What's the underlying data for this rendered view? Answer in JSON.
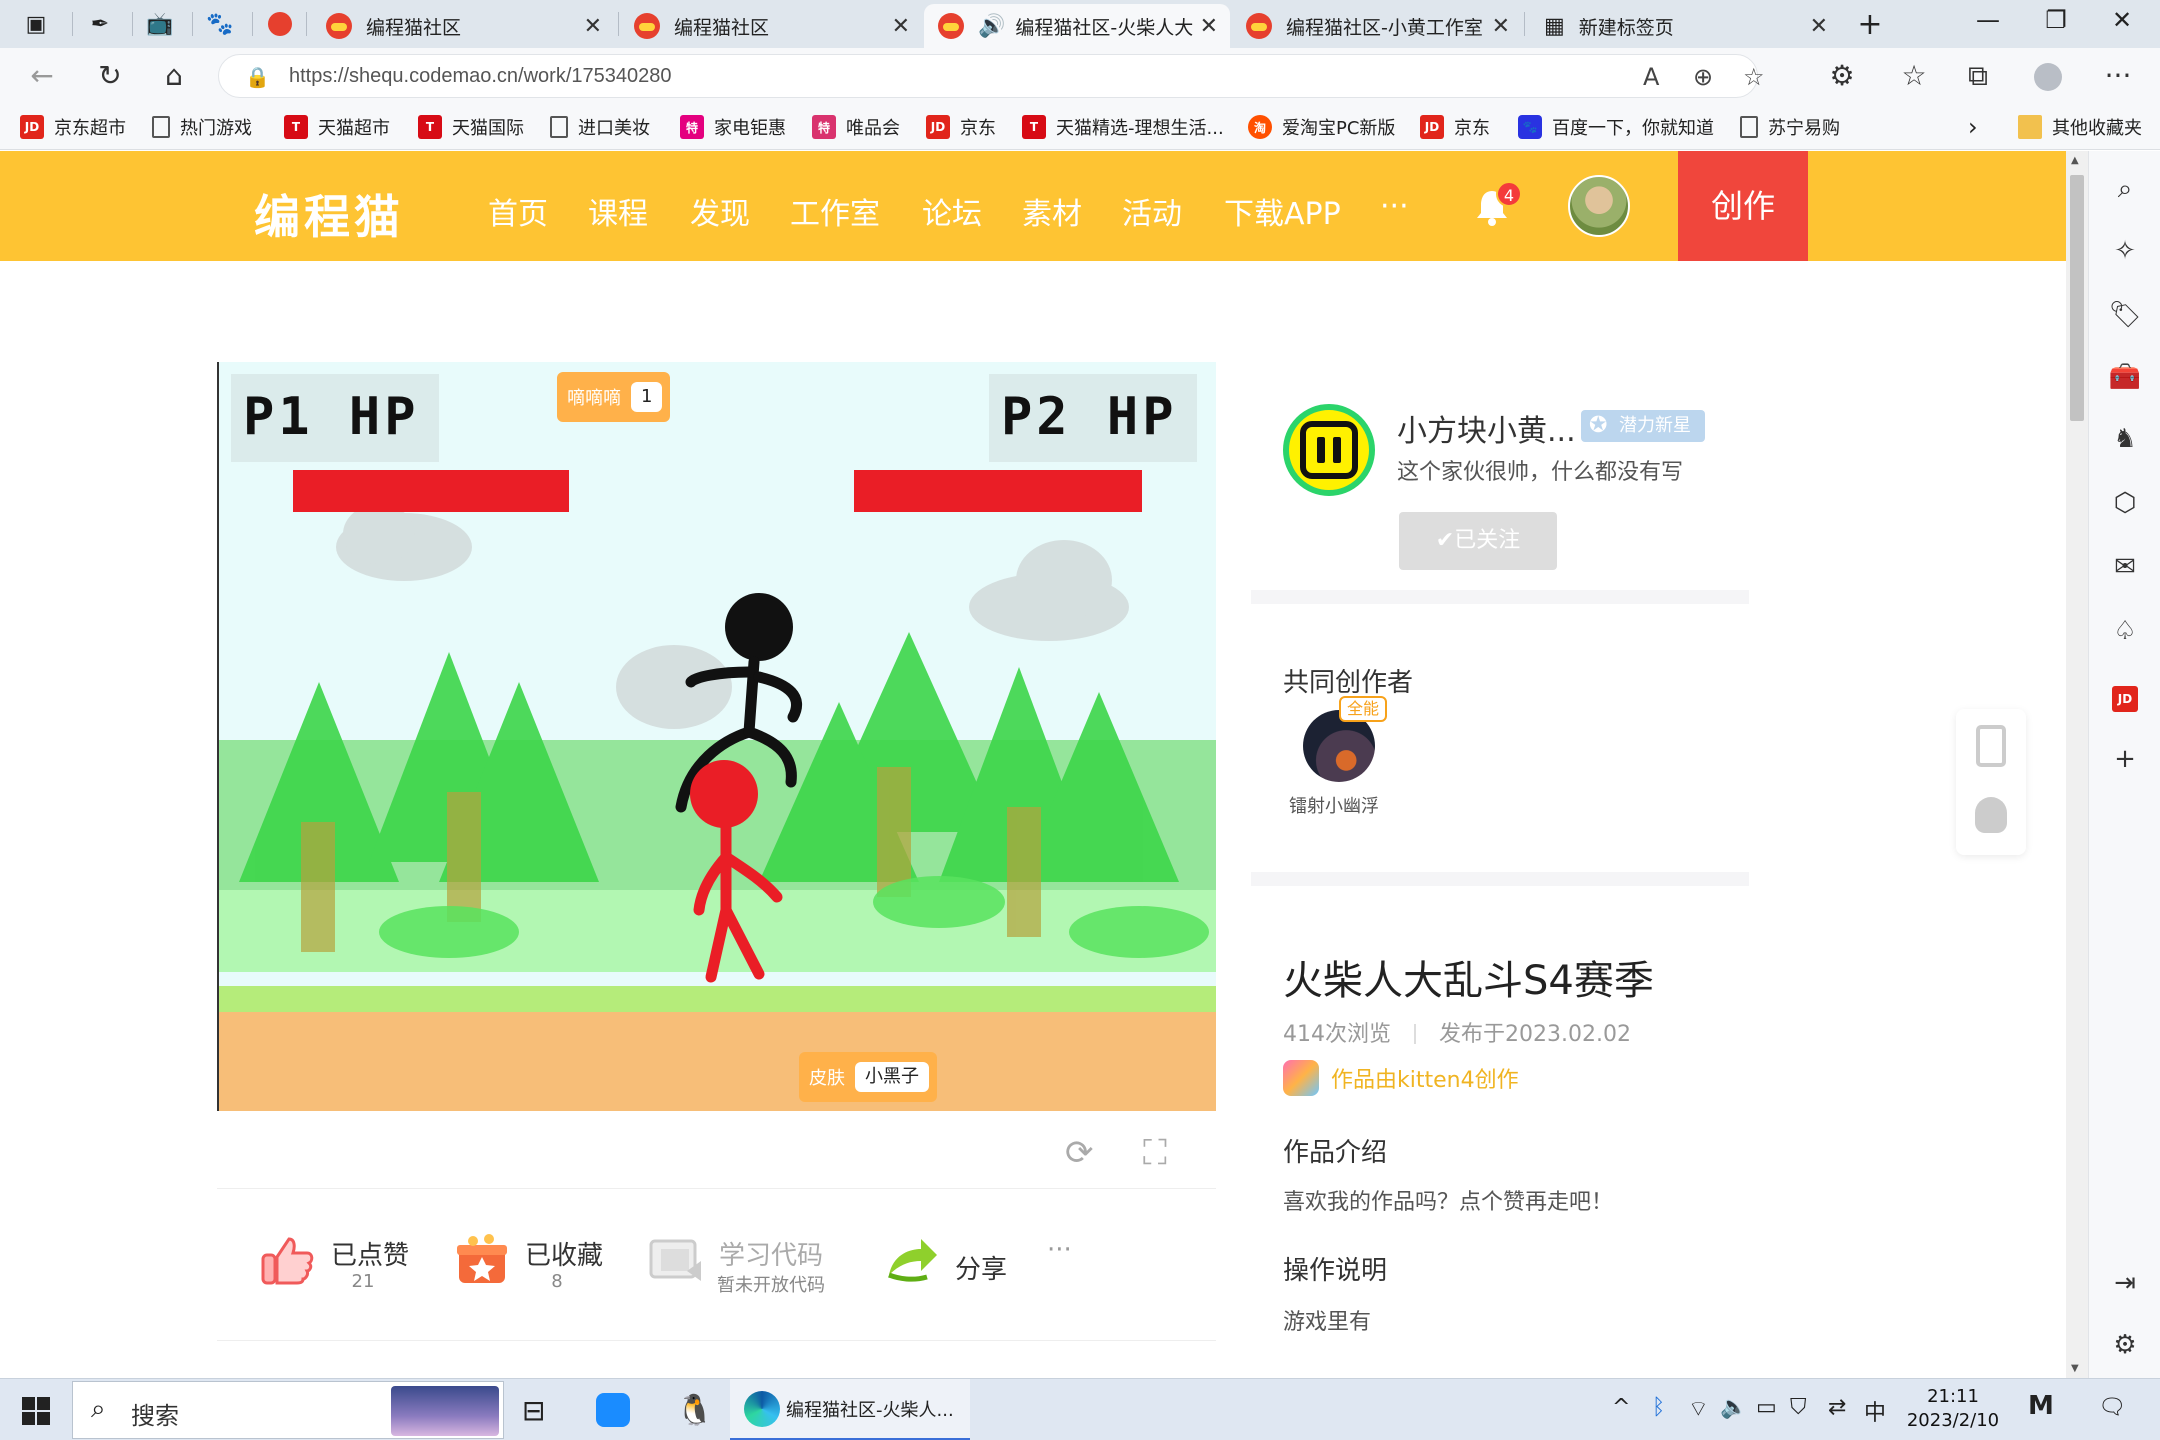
{
  "browser": {
    "tabs": [
      {
        "title": "编程猫社区"
      },
      {
        "title": "编程猫社区"
      },
      {
        "title": "编程猫社区-火柴人大"
      },
      {
        "title": "编程猫社区-小黄工作室（"
      },
      {
        "title": "新建标签页"
      }
    ],
    "url": "https://shequ.codemao.cn/work/175340280",
    "bookmarks": [
      {
        "label": "京东超市",
        "icon": "jd"
      },
      {
        "label": "热门游戏",
        "icon": "doc"
      },
      {
        "label": "天猫超市",
        "icon": "tm"
      },
      {
        "label": "天猫国际",
        "icon": "tm"
      },
      {
        "label": "进口美妆",
        "icon": "doc"
      },
      {
        "label": "家电钜惠",
        "icon": "te"
      },
      {
        "label": "唯品会",
        "icon": "vp"
      },
      {
        "label": "京东",
        "icon": "jd"
      },
      {
        "label": "天猫精选-理想生活...",
        "icon": "tm"
      },
      {
        "label": "爱淘宝PC新版",
        "icon": "tb"
      },
      {
        "label": "京东",
        "icon": "jd"
      },
      {
        "label": "百度一下，你就知道",
        "icon": "bd"
      },
      {
        "label": "苏宁易购",
        "icon": "doc"
      }
    ],
    "other_bookmarks": "其他收藏夹"
  },
  "site": {
    "logo": "编程猫",
    "nav": [
      "首页",
      "课程",
      "发现",
      "工作室",
      "论坛",
      "素材",
      "活动",
      "下载APP",
      "···"
    ],
    "notification_count": "4",
    "create_label": "创作",
    "brand_color": "#fec433"
  },
  "game": {
    "p1_label": "P1  HP",
    "p2_label": "P2  HP",
    "counter_label": "嘀嘀嘀",
    "counter_value": "1",
    "skin_label": "皮肤",
    "skin_value": "小黑子",
    "p1_hp_fraction": 1.0,
    "p2_hp_fraction": 1.0
  },
  "actions": {
    "like_label": "已点赞",
    "like_count": "21",
    "collect_label": "已收藏",
    "collect_count": "8",
    "code_label": "学习代码",
    "code_sub": "暂未开放代码",
    "share_label": "分享",
    "more": "···"
  },
  "author": {
    "name": "小方块小黄...",
    "badge": "潜力新星",
    "bio": "这个家伙很帅，什么都没有写",
    "follow_label": "✔已关注"
  },
  "co_creators": {
    "title": "共同创作者",
    "members": [
      {
        "name": "镭射小幽浮",
        "badge": "全能"
      }
    ]
  },
  "work": {
    "title": "火柴人大乱斗S4赛季",
    "views": "414次浏览",
    "published": "发布于2023.02.02",
    "made_with": "作品由kitten4创作",
    "intro_title": "作品介绍",
    "intro_text": "喜欢我的作品吗？点个赞再走吧！",
    "ops_title": "操作说明",
    "ops_text": "游戏里有"
  },
  "taskbar": {
    "search_label": "搜索",
    "edge_window": "编程猫社区-火柴人...",
    "ime": "中",
    "time": "21:11",
    "date": "2023/2/10"
  }
}
